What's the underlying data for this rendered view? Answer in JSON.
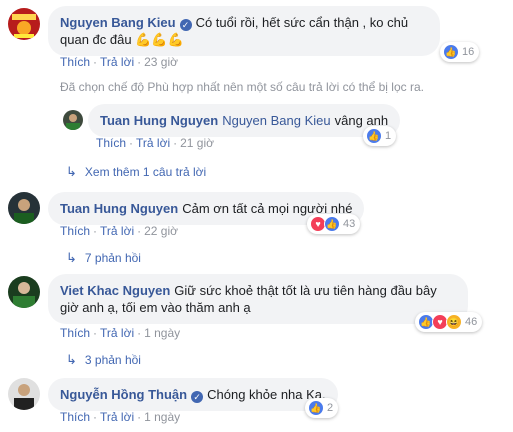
{
  "colors": {
    "author": "#385898",
    "action": "#4267b2",
    "muted": "#90949c",
    "bubble": "#f2f3f5",
    "like": "#4b7bec",
    "love": "#f33e58",
    "haha": "#f7b125"
  },
  "labels": {
    "like": "Thích",
    "reply": "Trả lời",
    "dot": "·"
  },
  "comments": [
    {
      "author": "Nguyen Bang Kieu",
      "verified": true,
      "text": "Có tuổi rồi, hết sức cẩn thận , ko chủ quan đc đâu",
      "emoji": "💪💪💪",
      "time": "23 giờ",
      "reactions": [
        "like-icon"
      ],
      "reaction_count": "16"
    },
    {
      "author": "Tuan Hung Nguyen",
      "verified": false,
      "text": "Cảm ơn tất cả mọi người nhé",
      "time": "22 giờ",
      "reactions": [
        "love-icon",
        "like-icon"
      ],
      "reaction_count": "43"
    },
    {
      "author": "Viet Khac Nguyen",
      "verified": false,
      "text": "Giữ sức khoẻ thật tốt là ưu tiên hàng đầu bây giờ anh ạ, tối em vào thăm anh ạ",
      "time": "1 ngày",
      "reactions": [
        "like-icon",
        "love-icon",
        "haha-icon"
      ],
      "reaction_count": "46"
    },
    {
      "author": "Nguyễn Hồng Thuận",
      "verified": true,
      "text": "Chóng khỏe nha Ka.",
      "time": "1 ngày",
      "reactions": [
        "like-icon"
      ],
      "reaction_count": "2"
    }
  ],
  "filter_notice": "Đã chọn chế độ Phù hợp nhất nên một số câu trả lời có thể bị lọc ra.",
  "reply": {
    "author": "Tuan Hung Nguyen",
    "mention": "Nguyen Bang Kieu",
    "text": "vâng anh",
    "time": "21 giờ",
    "reactions": [
      "like-icon"
    ],
    "reaction_count": "1"
  },
  "more_links": {
    "first": "Xem thêm 1 câu trả lời",
    "second": "7 phản hồi",
    "third": "3 phản hồi"
  }
}
